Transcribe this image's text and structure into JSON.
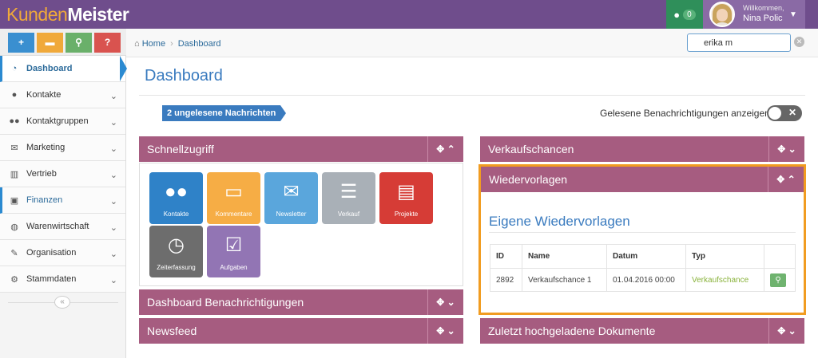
{
  "app": {
    "logo_part1": "Kunden",
    "logo_part2": "Meister"
  },
  "topbar": {
    "chat_count": "0",
    "welcome": "Willkommen,",
    "user_name": "Nina Polic"
  },
  "toolbar": {
    "buttons": [
      {
        "icon": "plus-icon",
        "glyph": "+",
        "color": "#3a8fd0"
      },
      {
        "icon": "comment-icon",
        "glyph": "💬",
        "color": "#f0a93a"
      },
      {
        "icon": "search-icon",
        "glyph": "🔍",
        "color": "#6ab06a"
      },
      {
        "icon": "help-icon",
        "glyph": "?",
        "color": "#d9534f"
      }
    ]
  },
  "sidebar": {
    "items": [
      {
        "label": "Dashboard",
        "icon": "dashboard-icon",
        "glyph": "◔"
      },
      {
        "label": "Kontakte",
        "icon": "user-icon",
        "glyph": "👤"
      },
      {
        "label": "Kontaktgruppen",
        "icon": "users-icon",
        "glyph": "👥"
      },
      {
        "label": "Marketing",
        "icon": "envelope-icon",
        "glyph": "✉"
      },
      {
        "label": "Vertrieb",
        "icon": "bar-chart-icon",
        "glyph": "📊"
      },
      {
        "label": "Finanzen",
        "icon": "money-icon",
        "glyph": "💵"
      },
      {
        "label": "Warenwirtschaft",
        "icon": "globe-icon",
        "glyph": "🌍"
      },
      {
        "label": "Organisation",
        "icon": "edit-icon",
        "glyph": "✎"
      },
      {
        "label": "Stammdaten",
        "icon": "cogs-icon",
        "glyph": "⚙"
      }
    ]
  },
  "breadcrumb": {
    "home": "Home",
    "current": "Dashboard"
  },
  "search": {
    "value": "erika m"
  },
  "page": {
    "title": "Dashboard",
    "unread_badge": "2 ungelesene Nachrichten",
    "show_read_label": "Gelesene Benachrichtigungen anzeigen"
  },
  "panels": {
    "schnellzugriff": "Schnellzugriff",
    "benachrichtigungen": "Dashboard Benachrichtigungen",
    "newsfeed": "Newsfeed",
    "verkaufschancen": "Verkaufschancen",
    "wiedervorlagen": "Wiedervorlagen",
    "dokumente": "Zuletzt hochgeladene Dokumente"
  },
  "tiles": [
    {
      "label": "Kontakte",
      "color": "#2f82c8",
      "icon": "users-icon",
      "glyph": "👥"
    },
    {
      "label": "Kommentare",
      "color": "#f6ad45",
      "icon": "comments-icon",
      "glyph": "💬"
    },
    {
      "label": "Newsletter",
      "color": "#5aa6dc",
      "icon": "envelope-open-icon",
      "glyph": "✉"
    },
    {
      "label": "Verkauf",
      "color": "#a9b0b7",
      "icon": "money-stack-icon",
      "glyph": "💰"
    },
    {
      "label": "Projekte",
      "color": "#d63c36",
      "icon": "clipboard-icon",
      "glyph": "📋"
    },
    {
      "label": "Zeiterfassung",
      "color": "#6d6d6d",
      "icon": "stopwatch-icon",
      "glyph": "⏱"
    },
    {
      "label": "Aufgaben",
      "color": "#9275b4",
      "icon": "checkbox-icon",
      "glyph": "☑"
    }
  ],
  "wiedervorlagen": {
    "title": "Eigene Wiedervorlagen",
    "columns": [
      "ID",
      "Name",
      "Datum",
      "Typ",
      ""
    ],
    "rows": [
      {
        "id": "2892",
        "name": "Verkaufschance 1",
        "datum": "01.04.2016 00:00",
        "typ": "Verkaufschance"
      }
    ]
  }
}
